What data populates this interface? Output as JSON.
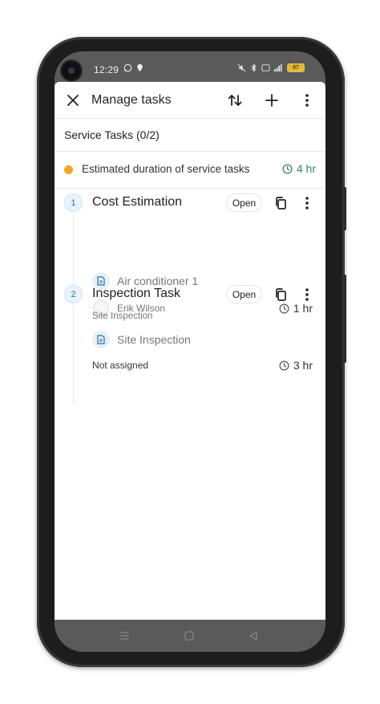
{
  "status_bar": {
    "time": "12:29",
    "battery": "87"
  },
  "toolbar": {
    "title": "Manage tasks",
    "icons": [
      "close-icon",
      "sort-icon",
      "add-icon",
      "more-vert-icon"
    ]
  },
  "section": {
    "title": "Service Tasks (0/2)"
  },
  "estimate": {
    "label": "Estimated duration of service tasks",
    "duration": "4 hr",
    "dot_color": "#f5a623",
    "duration_color": "#2e8b57"
  },
  "tasks": [
    {
      "number": "1",
      "name": "Cost Estimation",
      "status": "Open",
      "asset": "Air conditioner 1",
      "assignee": "Erik Wilson",
      "duration": "1 hr"
    },
    {
      "number": "2",
      "name": "Inspection Task",
      "status": "Open",
      "subtitle": "Site Inspection",
      "asset": "Site Inspection",
      "assignee": "Not assigned",
      "duration": "3 hr"
    }
  ]
}
